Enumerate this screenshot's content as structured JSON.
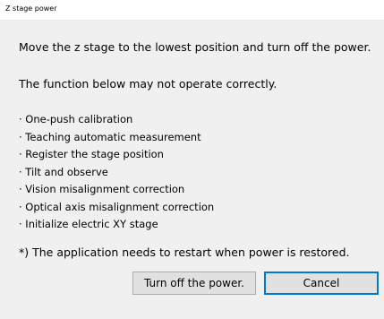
{
  "window": {
    "title": "Z stage power"
  },
  "body": {
    "instruction": "Move the z stage to the lowest position and turn off the power.",
    "warning": "The function below may not operate correctly.",
    "functions": [
      "· One-push calibration",
      "· Teaching automatic measurement",
      "· Register the stage position",
      "· Tilt and observe",
      "· Vision misalignment correction",
      "· Optical axis misalignment correction",
      "· Initialize electric XY stage"
    ],
    "note": "*) The application needs to restart when power is restored."
  },
  "buttons": {
    "turn_off": "Turn off the power.",
    "cancel": "Cancel"
  },
  "colors": {
    "focus_border": "#0078d7",
    "content_bg": "#f0f0f0"
  }
}
